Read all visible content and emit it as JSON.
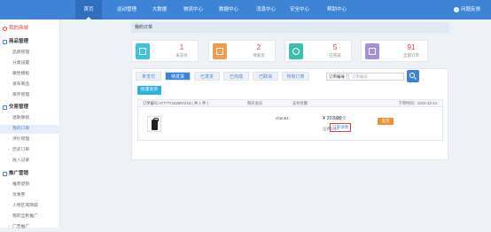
{
  "topnav": {
    "items": [
      {
        "label": "首页",
        "active": true
      },
      {
        "label": "运动管理"
      },
      {
        "label": "大数据"
      },
      {
        "label": "物流中心"
      },
      {
        "label": "数据中心"
      },
      {
        "label": "消息中心"
      },
      {
        "label": "安全中心"
      },
      {
        "label": "帮助中心"
      }
    ],
    "help": "问题反馈"
  },
  "sidebar": {
    "store": "我的商城",
    "sections": [
      {
        "title": "商品管理",
        "items": [
          "品牌管理",
          "分类设置",
          "属性模板",
          "发布商品",
          "库存管理"
        ]
      },
      {
        "title": "交易管理",
        "items": [
          "退款审核",
          "我的订单",
          "评价管理",
          "历史订单",
          "收入记录"
        ]
      },
      {
        "title": "推广营销",
        "items": [
          "推荐促销",
          "优惠券",
          "人物区域商城",
          "我的全民推广",
          "广告推广"
        ]
      }
    ],
    "active_item": "我的订单"
  },
  "breadcrumb": "我的订单",
  "stats": [
    {
      "value": "1",
      "label": "未支付",
      "color": "#3cc3e0"
    },
    {
      "value": "2",
      "label": "待发货",
      "color": "#f29b4c"
    },
    {
      "value": "5",
      "label": "已完成",
      "color": "#3bbfb0"
    },
    {
      "value": "91",
      "label": "全部订单",
      "color": "#a48fd8"
    }
  ],
  "tabs": [
    "未支付",
    "待发货",
    "已发货",
    "已完成",
    "已取消",
    "所有订单"
  ],
  "active_tab": "待发货",
  "search": {
    "select_label": "订单编号",
    "placeholder": "订单编号"
  },
  "ship_button": "批量发货",
  "order": {
    "header_no": "订单编号:477777162857216 ( 共 1 件 )",
    "header_buyer": "购买会员",
    "header_amount": "支付金额",
    "header_time": "下单时间：2023-12-14",
    "buyer": "chen51",
    "price": "¥ 203.00",
    "shipping": "运费0.00",
    "status": "待发货",
    "detail_link": "订单详情",
    "ship_action": "发货"
  }
}
